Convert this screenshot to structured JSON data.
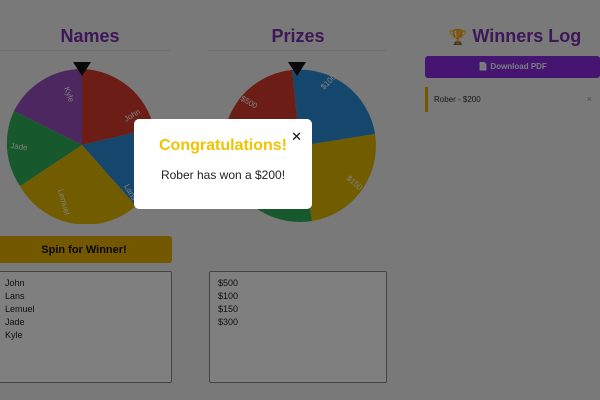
{
  "names": {
    "title": "Names",
    "spin_button": "Spin for Winner!",
    "entries": [
      "John",
      "Lans",
      "Lemuel",
      "Jade",
      "Kyle"
    ],
    "wheel_labels": [
      "John",
      "Lans",
      "Lemuel",
      "Jade",
      "Kyle"
    ]
  },
  "prizes": {
    "title": "Prizes",
    "entries": [
      "$500",
      "$100",
      "$150",
      "$300"
    ],
    "wheel_labels": [
      "$100",
      "$150",
      "$500"
    ]
  },
  "log": {
    "title": "Winners Log",
    "trophy_icon": "🏆",
    "download_label": "Download PDF",
    "download_icon": "📄",
    "items": [
      {
        "text": "Rober - $200",
        "remove_icon": "×"
      }
    ]
  },
  "modal": {
    "title": "Congratulations!",
    "message": "Rober has won a $200!",
    "close_icon": "✕"
  },
  "colors": {
    "accent": "#7b2fb0",
    "spin_button": "#e9b000",
    "download_button": "#8a2be2",
    "modal_title": "#f2c200",
    "wheel_red": "#d93a2b",
    "wheel_blue": "#2b8fd9",
    "wheel_yellow": "#e3b800",
    "wheel_green": "#2fb35a",
    "wheel_purple": "#9b4fbf"
  }
}
